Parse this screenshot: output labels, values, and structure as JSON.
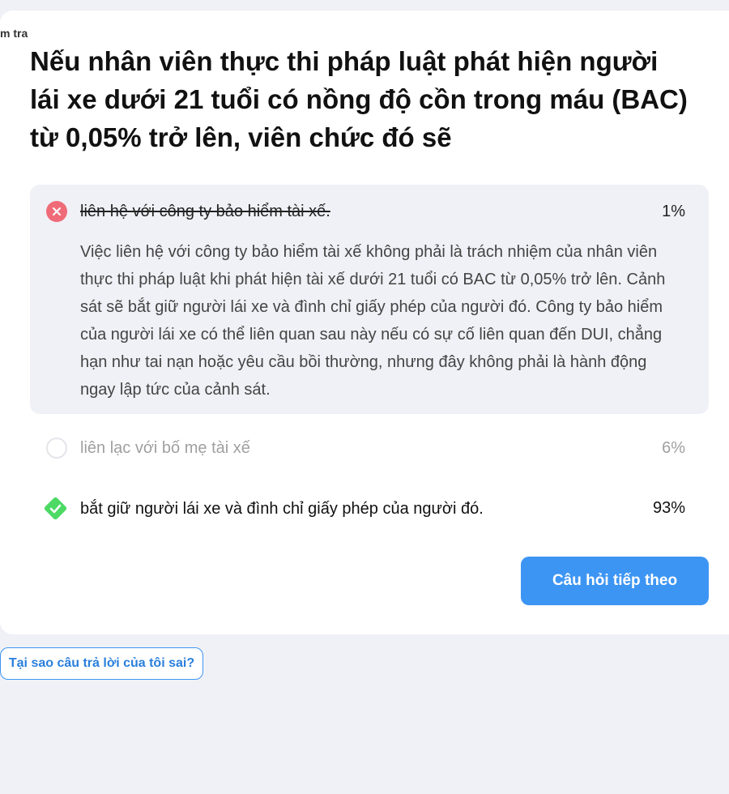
{
  "breadcrumb": "m tra",
  "question": "Nếu nhân viên thực thi pháp luật phát hiện người lái xe dưới 21 tuổi có nồng độ cồn trong máu (BAC) từ 0,05% trở lên, viên chức đó sẽ",
  "options": [
    {
      "label": "liên hệ với công ty bảo hiểm tài xế.",
      "percent": "1%",
      "state": "wrong-selected",
      "explanation": "Việc liên hệ với công ty bảo hiểm tài xế không phải là trách nhiệm của nhân viên thực thi pháp luật khi phát hiện tài xế dưới 21 tuổi có BAC từ 0,05% trở lên. Cảnh sát sẽ bắt giữ người lái xe và đình chỉ giấy phép của người đó. Công ty bảo hiểm của người lái xe có thể liên quan sau này nếu có sự cố liên quan đến DUI, chẳng hạn như tai nạn hoặc yêu cầu bồi thường, nhưng đây không phải là hành động ngay lập tức của cảnh sát."
    },
    {
      "label": "liên lạc với bố mẹ tài xế",
      "percent": "6%",
      "state": "unselected"
    },
    {
      "label": "bắt giữ người lái xe và đình chỉ giấy phép của người đó.",
      "percent": "93%",
      "state": "correct"
    }
  ],
  "buttons": {
    "next": "Câu hỏi tiếp theo",
    "why_wrong": "Tại sao câu trả lời của tôi sai?"
  },
  "colors": {
    "accent": "#3d95f3",
    "wrong": "#f06b78",
    "correct": "#4cd964",
    "muted_text": "#a0a0a0"
  }
}
